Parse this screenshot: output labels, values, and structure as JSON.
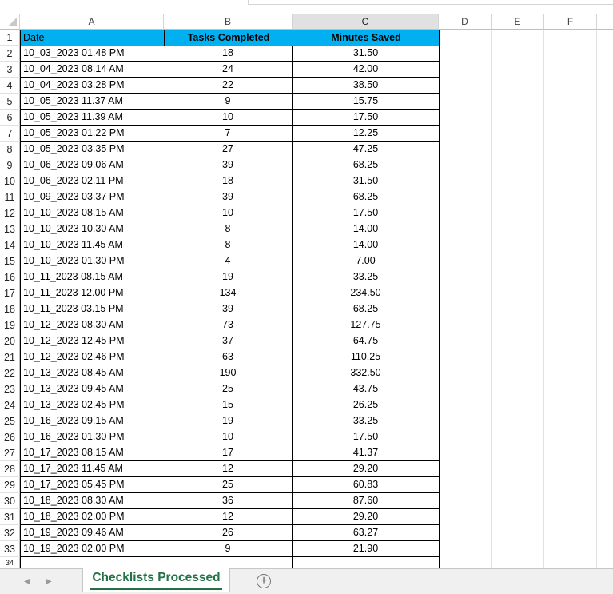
{
  "columns": [
    "A",
    "B",
    "C",
    "D",
    "E",
    "F"
  ],
  "selected_column": "C",
  "headers": {
    "a": "Date",
    "b": "Tasks Completed",
    "c": "Minutes Saved"
  },
  "rows": [
    {
      "n": "2",
      "date": "10_03_2023 01.48 PM",
      "tasks": "18",
      "minutes": "31.50"
    },
    {
      "n": "3",
      "date": "10_04_2023 08.14 AM",
      "tasks": "24",
      "minutes": "42.00"
    },
    {
      "n": "4",
      "date": "10_04_2023 03.28 PM",
      "tasks": "22",
      "minutes": "38.50"
    },
    {
      "n": "5",
      "date": "10_05_2023 11.37 AM",
      "tasks": "9",
      "minutes": "15.75"
    },
    {
      "n": "6",
      "date": "10_05_2023 11.39 AM",
      "tasks": "10",
      "minutes": "17.50"
    },
    {
      "n": "7",
      "date": "10_05_2023 01.22 PM",
      "tasks": "7",
      "minutes": "12.25"
    },
    {
      "n": "8",
      "date": "10_05_2023 03.35 PM",
      "tasks": "27",
      "minutes": "47.25"
    },
    {
      "n": "9",
      "date": "10_06_2023 09.06 AM",
      "tasks": "39",
      "minutes": "68.25"
    },
    {
      "n": "10",
      "date": "10_06_2023 02.11 PM",
      "tasks": "18",
      "minutes": "31.50"
    },
    {
      "n": "11",
      "date": "10_09_2023 03.37 PM",
      "tasks": "39",
      "minutes": "68.25"
    },
    {
      "n": "12",
      "date": "10_10_2023 08.15 AM",
      "tasks": "10",
      "minutes": "17.50"
    },
    {
      "n": "13",
      "date": "10_10_2023 10.30 AM",
      "tasks": "8",
      "minutes": "14.00"
    },
    {
      "n": "14",
      "date": "10_10_2023 11.45 AM",
      "tasks": "8",
      "minutes": "14.00"
    },
    {
      "n": "15",
      "date": "10_10_2023 01.30 PM",
      "tasks": "4",
      "minutes": "7.00"
    },
    {
      "n": "16",
      "date": "10_11_2023 08.15 AM",
      "tasks": "19",
      "minutes": "33.25"
    },
    {
      "n": "17",
      "date": "10_11_2023 12.00 PM",
      "tasks": "134",
      "minutes": "234.50"
    },
    {
      "n": "18",
      "date": "10_11_2023 03.15 PM",
      "tasks": "39",
      "minutes": "68.25"
    },
    {
      "n": "19",
      "date": "10_12_2023 08.30 AM",
      "tasks": "73",
      "minutes": "127.75"
    },
    {
      "n": "20",
      "date": "10_12_2023 12.45 PM",
      "tasks": "37",
      "minutes": "64.75"
    },
    {
      "n": "21",
      "date": "10_12_2023 02.46 PM",
      "tasks": "63",
      "minutes": "110.25"
    },
    {
      "n": "22",
      "date": "10_13_2023 08.45 AM",
      "tasks": "190",
      "minutes": "332.50"
    },
    {
      "n": "23",
      "date": "10_13_2023 09.45 AM",
      "tasks": "25",
      "minutes": "43.75"
    },
    {
      "n": "24",
      "date": "10_13_2023 02.45 PM",
      "tasks": "15",
      "minutes": "26.25"
    },
    {
      "n": "25",
      "date": "10_16_2023 09.15 AM",
      "tasks": "19",
      "minutes": "33.25"
    },
    {
      "n": "26",
      "date": "10_16_2023 01.30 PM",
      "tasks": "10",
      "minutes": "17.50"
    },
    {
      "n": "27",
      "date": "10_17_2023 08.15 AM",
      "tasks": "17",
      "minutes": "41.37"
    },
    {
      "n": "28",
      "date": "10_17_2023 11.45 AM",
      "tasks": "12",
      "minutes": "29.20"
    },
    {
      "n": "29",
      "date": "10_17_2023 05.45 PM",
      "tasks": "25",
      "minutes": "60.83"
    },
    {
      "n": "30",
      "date": "10_18_2023 08.30 AM",
      "tasks": "36",
      "minutes": "87.60"
    },
    {
      "n": "31",
      "date": "10_18_2023 02.00 PM",
      "tasks": "12",
      "minutes": "29.20"
    },
    {
      "n": "32",
      "date": "10_19_2023 09.46 AM",
      "tasks": "26",
      "minutes": "63.27"
    },
    {
      "n": "33",
      "date": "10_19_2023 02.00 PM",
      "tasks": "9",
      "minutes": "21.90"
    }
  ],
  "header_row_number": "1",
  "partial_row_number": "34",
  "sheet_tab": {
    "label": "Checklists Processed"
  },
  "nav_icons": {
    "prev": "chevron-left-icon",
    "next": "chevron-right-icon",
    "add": "plus-circle-icon"
  },
  "colors": {
    "header_fill": "#00b0f0",
    "tab_accent": "#217346",
    "selected_col_fill": "#e1e1e1"
  }
}
